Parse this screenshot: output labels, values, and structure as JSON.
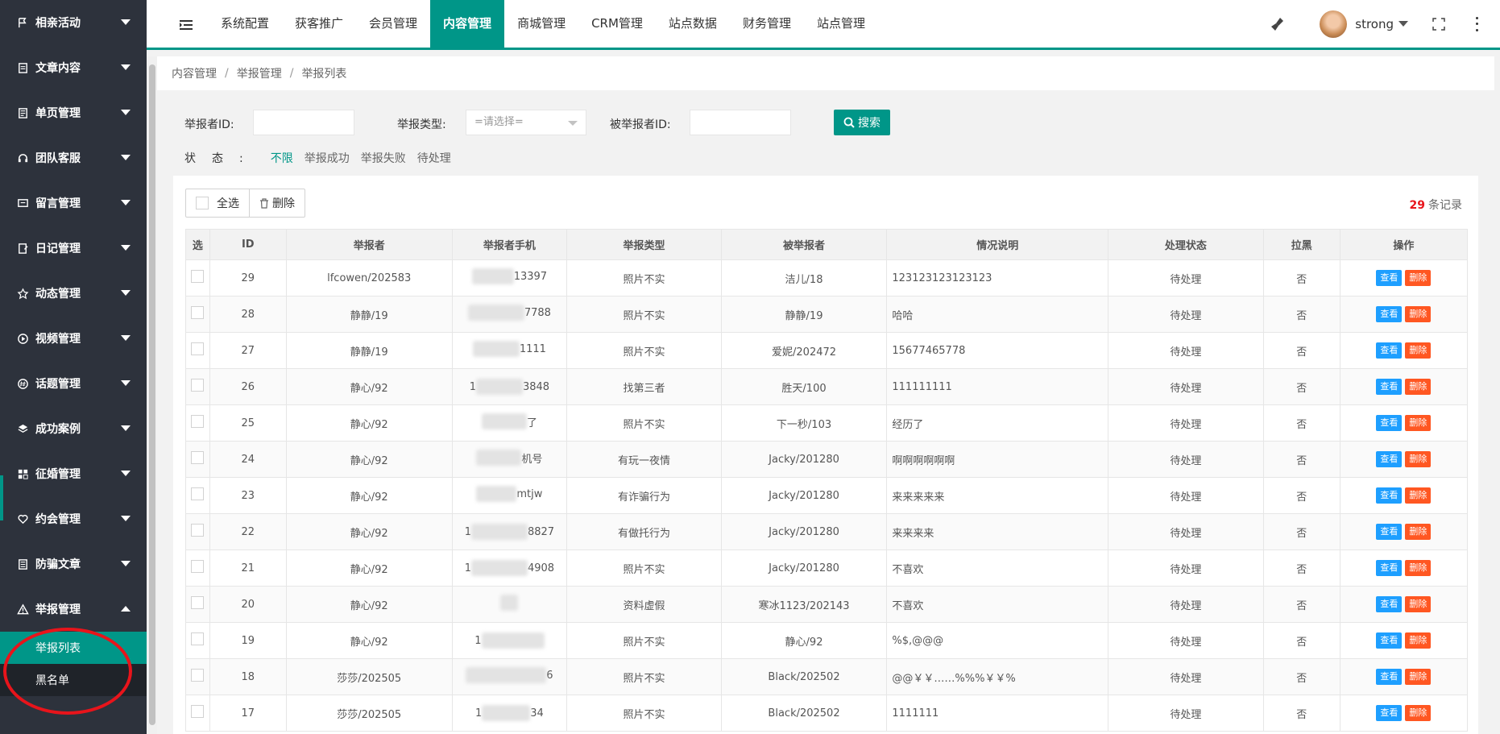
{
  "sidebar": {
    "items": [
      {
        "label": "相亲活动",
        "icon": "flag-icon"
      },
      {
        "label": "文章内容",
        "icon": "document-icon"
      },
      {
        "label": "单页管理",
        "icon": "page-icon"
      },
      {
        "label": "团队客服",
        "icon": "headset-icon"
      },
      {
        "label": "留言管理",
        "icon": "message-icon"
      },
      {
        "label": "日记管理",
        "icon": "diary-icon"
      },
      {
        "label": "动态管理",
        "icon": "star-icon"
      },
      {
        "label": "视频管理",
        "icon": "play-icon"
      },
      {
        "label": "话题管理",
        "icon": "topic-icon"
      },
      {
        "label": "成功案例",
        "icon": "layers-icon"
      },
      {
        "label": "征婚管理",
        "icon": "grid-icon"
      },
      {
        "label": "约会管理",
        "icon": "heart-icon"
      },
      {
        "label": "防骗文章",
        "icon": "article-icon"
      },
      {
        "label": "举报管理",
        "icon": "warning-icon"
      }
    ],
    "sub_items": [
      {
        "label": "举报列表"
      },
      {
        "label": "黑名单"
      }
    ]
  },
  "topnav": {
    "items": [
      "系统配置",
      "获客推广",
      "会员管理",
      "内容管理",
      "商城管理",
      "CRM管理",
      "站点数据",
      "财务管理",
      "站点管理"
    ],
    "active_index": 3,
    "username": "strong"
  },
  "breadcrumb": [
    "内容管理",
    "举报管理",
    "举报列表"
  ],
  "search": {
    "reporter_id_label": "举报者ID:",
    "type_label": "举报类型:",
    "type_placeholder": "=请选择=",
    "reported_id_label": "被举报者ID:",
    "search_button": "搜索",
    "status_label": "状态:",
    "status_options": [
      "不限",
      "举报成功",
      "举报失败",
      "待处理"
    ],
    "status_active": "不限"
  },
  "toolbar": {
    "select_all": "全选",
    "delete": "删除",
    "record_count": "29",
    "record_suffix": "条记录"
  },
  "table": {
    "headers": [
      "选",
      "ID",
      "举报者",
      "举报者手机",
      "举报类型",
      "被举报者",
      "情况说明",
      "处理状态",
      "拉黑",
      "操作"
    ],
    "view_label": "查看",
    "delete_label": "删除",
    "rows": [
      {
        "id": "29",
        "reporter": "lfcowen/202583",
        "phone": "13397",
        "type": "照片不实",
        "target": "洁儿/18",
        "desc": "123123123123123",
        "status": "待处理",
        "black": "否"
      },
      {
        "id": "28",
        "reporter": "静静/19",
        "phone": "7788",
        "type": "照片不实",
        "target": "静静/19",
        "desc": "哈哈",
        "status": "待处理",
        "black": "否"
      },
      {
        "id": "27",
        "reporter": "静静/19",
        "phone": "1111",
        "type": "照片不实",
        "target": "爱妮/202472",
        "desc": "15677465778",
        "status": "待处理",
        "black": "否"
      },
      {
        "id": "26",
        "reporter": "静心/92",
        "phone": "3848",
        "type": "找第三者",
        "target": "胜天/100",
        "desc": "111111111",
        "status": "待处理",
        "black": "否"
      },
      {
        "id": "25",
        "reporter": "静心/92",
        "phone": "了",
        "type": "照片不实",
        "target": "下一秒/103",
        "desc": "经历了",
        "status": "待处理",
        "black": "否"
      },
      {
        "id": "24",
        "reporter": "静心/92",
        "phone": "机号",
        "type": "有玩一夜情",
        "target": "Jacky/201280",
        "desc": "啊啊啊啊啊啊",
        "status": "待处理",
        "black": "否"
      },
      {
        "id": "23",
        "reporter": "静心/92",
        "phone": "mtjw",
        "type": "有诈骗行为",
        "target": "Jacky/201280",
        "desc": "来来来来来",
        "status": "待处理",
        "black": "否"
      },
      {
        "id": "22",
        "reporter": "静心/92",
        "phone": "8827",
        "type": "有做托行为",
        "target": "Jacky/201280",
        "desc": "来来来来",
        "status": "待处理",
        "black": "否"
      },
      {
        "id": "21",
        "reporter": "静心/92",
        "phone": "4908",
        "type": "照片不实",
        "target": "Jacky/201280",
        "desc": "不喜欢",
        "status": "待处理",
        "black": "否"
      },
      {
        "id": "20",
        "reporter": "静心/92",
        "phone": "",
        "type": "资料虚假",
        "target": "寒冰1123/202143",
        "desc": "不喜欢",
        "status": "待处理",
        "black": "否"
      },
      {
        "id": "19",
        "reporter": "静心/92",
        "phone": "",
        "type": "照片不实",
        "target": "静心/92",
        "desc": "%$,@@@",
        "status": "待处理",
        "black": "否"
      },
      {
        "id": "18",
        "reporter": "莎莎/202505",
        "phone": "6",
        "type": "照片不实",
        "target": "Black/202502",
        "desc": "@@￥￥……%%%￥￥%",
        "status": "待处理",
        "black": "否"
      },
      {
        "id": "17",
        "reporter": "莎莎/202505",
        "phone": "34",
        "type": "照片不实",
        "target": "Black/202502",
        "desc": "1111111",
        "status": "待处理",
        "black": "否"
      }
    ]
  },
  "colors": {
    "accent": "#009688",
    "sidebar_bg": "#2d323c",
    "view_btn": "#1e9fff",
    "delete_btn": "#ff5722",
    "annotation": "#e8141b"
  }
}
